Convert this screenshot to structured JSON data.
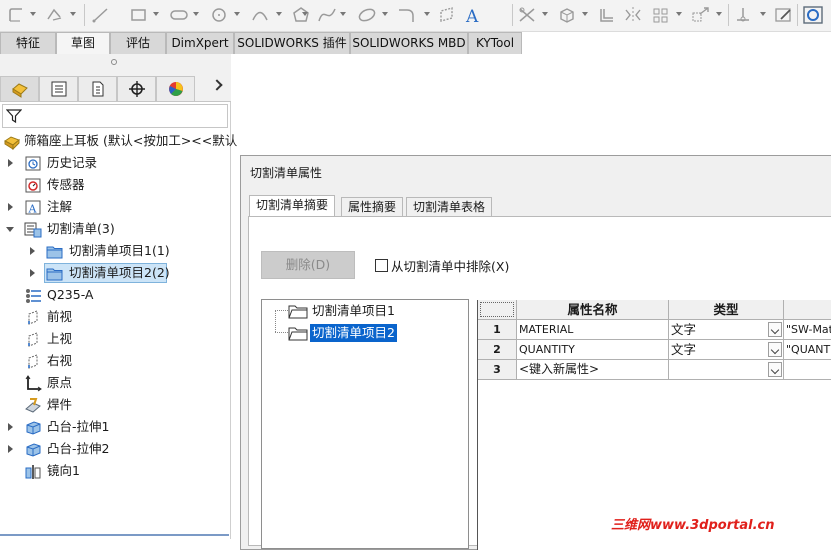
{
  "command_tabs": [
    "特征",
    "草图",
    "评估",
    "DimXpert",
    "SOLIDWORKS 插件",
    "SOLIDWORKS MBD",
    "KYTool"
  ],
  "active_command_tab": "草图",
  "feature_tree": {
    "root": "筛箱座上耳板 (默认<按加工><<默认",
    "items": [
      {
        "label": "历史记录",
        "icon": "history-icon"
      },
      {
        "label": "传感器",
        "icon": "sensor-icon"
      },
      {
        "label": "注解",
        "icon": "annotation-icon"
      },
      {
        "label": "切割清单(3)",
        "icon": "cutlist-icon"
      },
      {
        "label": "切割清单项目1(1)",
        "icon": "cutlist-folder-icon"
      },
      {
        "label": "切割清单项目2(2)",
        "icon": "cutlist-folder-icon"
      },
      {
        "label": "Q235-A",
        "icon": "material-icon"
      },
      {
        "label": "前视",
        "icon": "plane-icon"
      },
      {
        "label": "上视",
        "icon": "plane-icon"
      },
      {
        "label": "右视",
        "icon": "plane-icon"
      },
      {
        "label": "原点",
        "icon": "origin-icon"
      },
      {
        "label": "焊件",
        "icon": "weldment-icon"
      },
      {
        "label": "凸台-拉伸1",
        "icon": "boss-extrude-icon"
      },
      {
        "label": "凸台-拉伸2",
        "icon": "boss-extrude-icon"
      },
      {
        "label": "镜向1",
        "icon": "mirror-icon"
      }
    ]
  },
  "dialog": {
    "title": "切割清单属性",
    "tabs": [
      "切割清单摘要",
      "属性摘要",
      "切割清单表格"
    ],
    "delete_button": "删除(D)",
    "exclude_label": "从切割清单中排除(X)",
    "list_items": [
      "切割清单项目1",
      "切割清单项目2"
    ],
    "grid": {
      "headers": [
        "属性名称",
        "类型",
        ""
      ],
      "rows": [
        {
          "num": "1",
          "name": "MATERIAL",
          "type": "文字",
          "value": "\"SW-Materi"
        },
        {
          "num": "2",
          "name": "QUANTITY",
          "type": "文字",
          "value": "\"QUANTITY@"
        },
        {
          "num": "3",
          "name": "<键入新属性>",
          "type": "",
          "value": ""
        }
      ]
    }
  },
  "watermark": "三维网www.3dportal.cn",
  "colors": {
    "selection": "#0a64cc",
    "watermark": "#e0201b",
    "accent": "#1f6fc5"
  }
}
